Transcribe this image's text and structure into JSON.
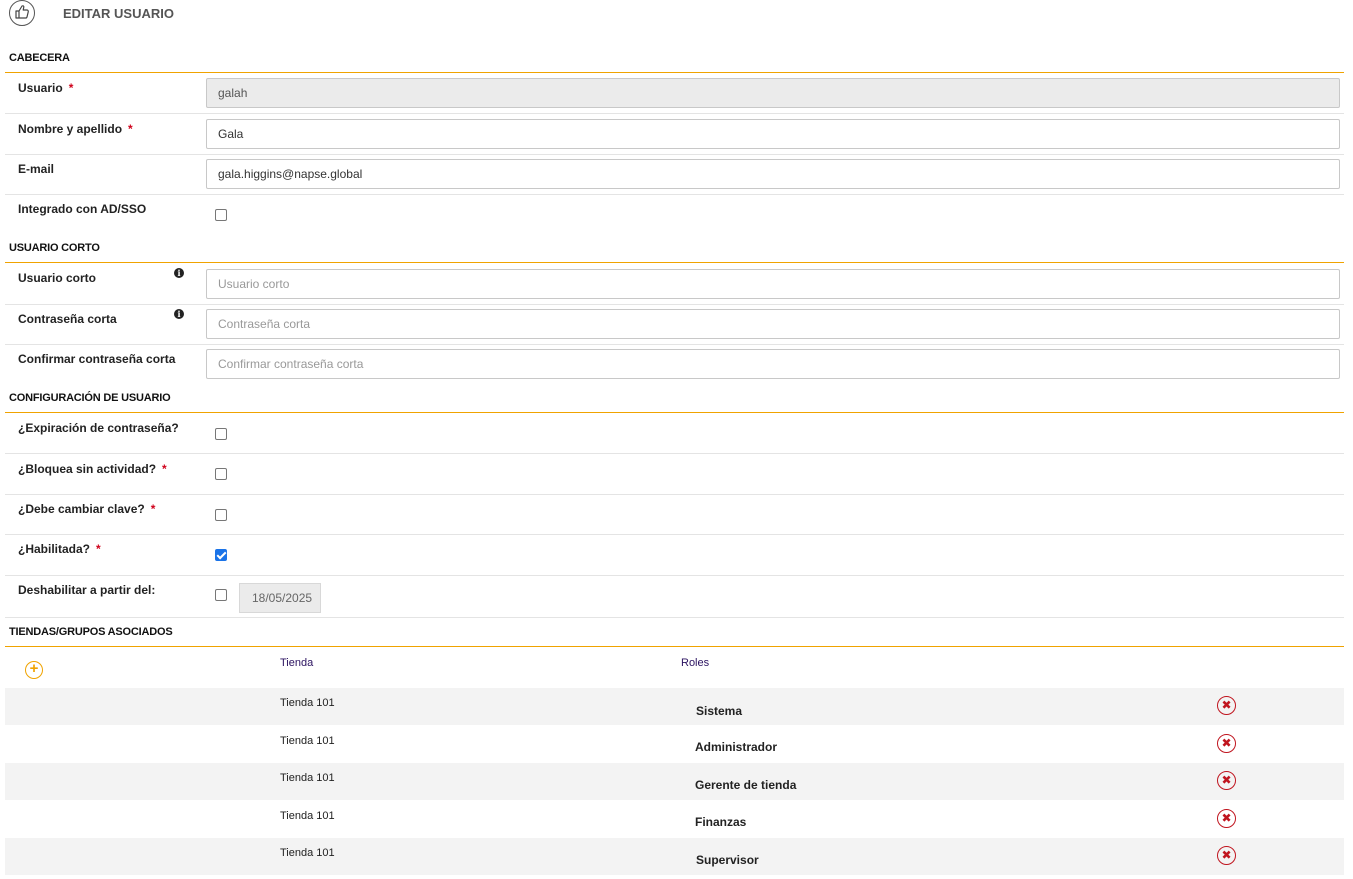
{
  "header": {
    "title": "EDITAR USUARIO",
    "icon": "thumbs-up-icon"
  },
  "sections": {
    "cabecera": "CABECERA",
    "usuario_corto": "USUARIO CORTO",
    "configuracion": "CONFIGURACIÓN DE USUARIO",
    "tiendas": "TIENDAS/GRUPOS ASOCIADOS"
  },
  "fields": {
    "usuario": {
      "label": "Usuario",
      "required": "*",
      "value": "galah"
    },
    "nombre": {
      "label": "Nombre y apellido",
      "required": "*",
      "value": "Gala"
    },
    "email": {
      "label": "E-mail",
      "value": "gala.higgins@napse.global"
    },
    "integrado": {
      "label": "Integrado con AD/SSO",
      "checked": false
    },
    "usuario_corto": {
      "label": "Usuario corto",
      "placeholder": "Usuario corto"
    },
    "contrasena_corta": {
      "label": "Contraseña corta",
      "placeholder": "Contraseña corta"
    },
    "confirmar_contrasena": {
      "label": "Confirmar contraseña corta",
      "placeholder": "Confirmar contraseña corta"
    },
    "expiracion": {
      "label": "¿Expiración de contraseña?",
      "checked": false
    },
    "bloquea": {
      "label": "¿Bloquea sin actividad?",
      "required": "*",
      "checked": false
    },
    "cambiar_clave": {
      "label": "¿Debe cambiar clave?",
      "required": "*",
      "checked": false
    },
    "habilitada": {
      "label": "¿Habilitada?",
      "required": "*",
      "checked": true
    },
    "deshabilitar": {
      "label": "Deshabilitar a partir del:",
      "checked": false,
      "date": "18/05/2025"
    }
  },
  "table": {
    "headers": {
      "tienda": "Tienda",
      "roles": "Roles"
    },
    "rows": [
      {
        "tienda": "Tienda 101",
        "rol": "Sistema"
      },
      {
        "tienda": "Tienda 101",
        "rol": "Administrador"
      },
      {
        "tienda": "Tienda 101",
        "rol": "Gerente de tienda"
      },
      {
        "tienda": "Tienda 101",
        "rol": "Finanzas"
      },
      {
        "tienda": "Tienda 101",
        "rol": "Supervisor"
      }
    ]
  },
  "colors": {
    "accent": "#f0a300",
    "required": "#d0021b",
    "delete": "#c0151f",
    "checkbox": "#1a73e8"
  }
}
